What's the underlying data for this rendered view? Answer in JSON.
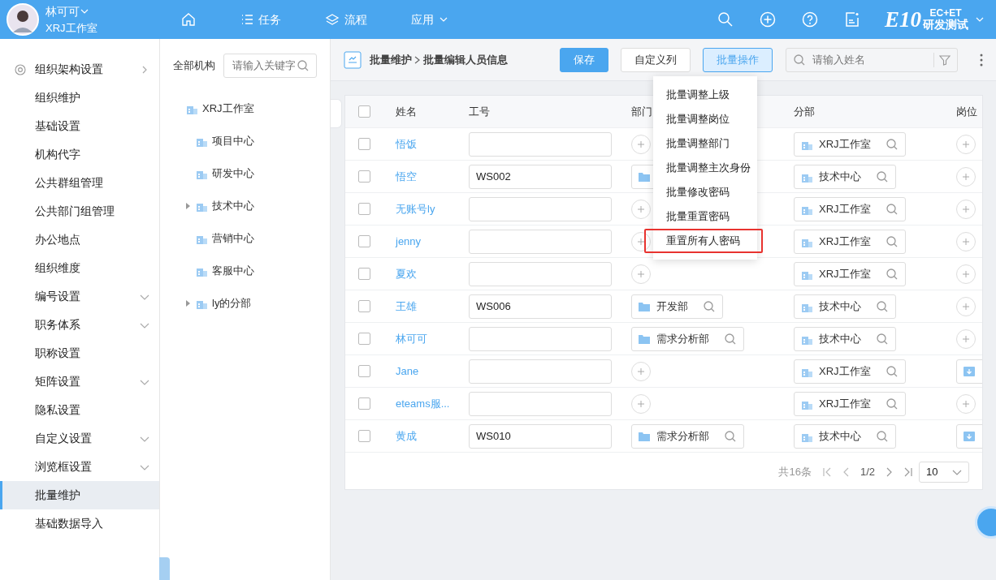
{
  "user": {
    "name": "林可可",
    "org": "XRJ工作室"
  },
  "nav": [
    {
      "kind": "home"
    },
    {
      "kind": "list",
      "label": "任务"
    },
    {
      "kind": "layers",
      "label": "流程"
    },
    {
      "kind": "dropdown",
      "label": "应用"
    }
  ],
  "header_icons": [
    {
      "kind": "search"
    },
    {
      "kind": "add"
    },
    {
      "kind": "help"
    },
    {
      "kind": "note"
    }
  ],
  "brand": {
    "mark": "E10",
    "top": "EC+ET",
    "bottom": "研发测试"
  },
  "sidebar": {
    "items": [
      {
        "label": "组织架构设置",
        "kind": "header",
        "selected": false
      },
      {
        "label": "组织维护",
        "kind": "plain",
        "selected": false
      },
      {
        "label": "基础设置",
        "kind": "plain",
        "selected": false
      },
      {
        "label": "机构代字",
        "kind": "plain",
        "selected": false
      },
      {
        "label": "公共群组管理",
        "kind": "plain",
        "selected": false
      },
      {
        "label": "公共部门组管理",
        "kind": "plain",
        "selected": false
      },
      {
        "label": "办公地点",
        "kind": "plain",
        "selected": false
      },
      {
        "label": "组织维度",
        "kind": "plain",
        "selected": false
      },
      {
        "label": "编号设置",
        "kind": "expandable",
        "selected": false
      },
      {
        "label": "职务体系",
        "kind": "expandable",
        "selected": false
      },
      {
        "label": "职称设置",
        "kind": "plain",
        "selected": false
      },
      {
        "label": "矩阵设置",
        "kind": "expandable",
        "selected": false
      },
      {
        "label": "隐私设置",
        "kind": "plain",
        "selected": false
      },
      {
        "label": "自定义设置",
        "kind": "expandable",
        "selected": false
      },
      {
        "label": "浏览框设置",
        "kind": "expandable",
        "selected": false
      },
      {
        "label": "批量维护",
        "kind": "plain",
        "selected": true
      },
      {
        "label": "基础数据导入",
        "kind": "plain",
        "selected": false
      }
    ]
  },
  "tree": {
    "label": "全部机构",
    "search": {
      "placeholder": "请输入关键字"
    },
    "nodes": [
      {
        "label": "XRJ工作室",
        "children": [
          {
            "label": "项目中心"
          },
          {
            "label": "研发中心"
          },
          {
            "label": "技术中心",
            "expanded": false
          },
          {
            "label": "营销中心"
          },
          {
            "label": "客服中心"
          },
          {
            "label": "ly的分部",
            "expanded": false
          }
        ]
      }
    ]
  },
  "toolbar": {
    "breadcrumb": [
      "批量维护",
      "批量编辑人员信息"
    ],
    "buttons": [
      {
        "label": "保存",
        "kind": "primary",
        "selected": false
      },
      {
        "label": "自定义列",
        "kind": "default",
        "selected": false
      },
      {
        "label": "批量操作",
        "kind": "default",
        "selected": true
      }
    ],
    "search": {
      "placeholder": "请输入姓名"
    }
  },
  "menu": {
    "items": [
      {
        "label": "批量调整上级",
        "highlighted": false
      },
      {
        "label": "批量调整岗位",
        "highlighted": false
      },
      {
        "label": "批量调整部门",
        "highlighted": false
      },
      {
        "label": "批量调整主次身份",
        "highlighted": false
      },
      {
        "label": "批量修改密码",
        "highlighted": false
      },
      {
        "label": "批量重置密码",
        "highlighted": false
      },
      {
        "label": "重置所有人密码",
        "highlighted": true
      }
    ]
  },
  "table": {
    "header_checked": false,
    "columns": [
      "姓名",
      "工号",
      "部门",
      "分部",
      "岗位"
    ],
    "rows": [
      {
        "checked": false,
        "name": "悟饭",
        "dept": {
          "kind": "add"
        },
        "branch": "XRJ工作室",
        "post": {
          "kind": "add"
        }
      },
      {
        "checked": false,
        "name": "悟空",
        "id": "WS002",
        "dept": {
          "kind": "chip"
        },
        "branch": "技术中心",
        "post": {
          "kind": "add"
        }
      },
      {
        "checked": false,
        "name": "无账号ly",
        "dept": {
          "kind": "add"
        },
        "branch": "XRJ工作室",
        "post": {
          "kind": "add"
        }
      },
      {
        "checked": false,
        "name": "jenny",
        "dept": {
          "kind": "add"
        },
        "branch": "XRJ工作室",
        "post": {
          "kind": "add"
        }
      },
      {
        "checked": false,
        "name": "夏欢",
        "dept": {
          "kind": "add"
        },
        "branch": "XRJ工作室",
        "post": {
          "kind": "add"
        }
      },
      {
        "checked": false,
        "name": "王雄",
        "id": "WS006",
        "dept": {
          "kind": "chip",
          "name": "开发部"
        },
        "branch": "技术中心",
        "post": {
          "kind": "add"
        }
      },
      {
        "checked": false,
        "name": "林可可",
        "dept": {
          "kind": "chip",
          "name": "需求分析部"
        },
        "branch": "技术中心",
        "post": {
          "kind": "add"
        }
      },
      {
        "checked": false,
        "name": "Jane",
        "dept": {
          "kind": "add"
        },
        "branch": "XRJ工作室",
        "post": {
          "kind": "chip"
        }
      },
      {
        "checked": false,
        "name": "eteams服...",
        "dept": {
          "kind": "add"
        },
        "branch": "XRJ工作室",
        "post": {
          "kind": "add"
        }
      },
      {
        "checked": false,
        "name": "黄成",
        "id": "WS010",
        "dept": {
          "kind": "chip",
          "name": "需求分析部"
        },
        "branch": "技术中心",
        "post": {
          "kind": "chip"
        }
      }
    ]
  },
  "pagination": {
    "total": "共16条",
    "page": "1/2",
    "size": "10"
  }
}
